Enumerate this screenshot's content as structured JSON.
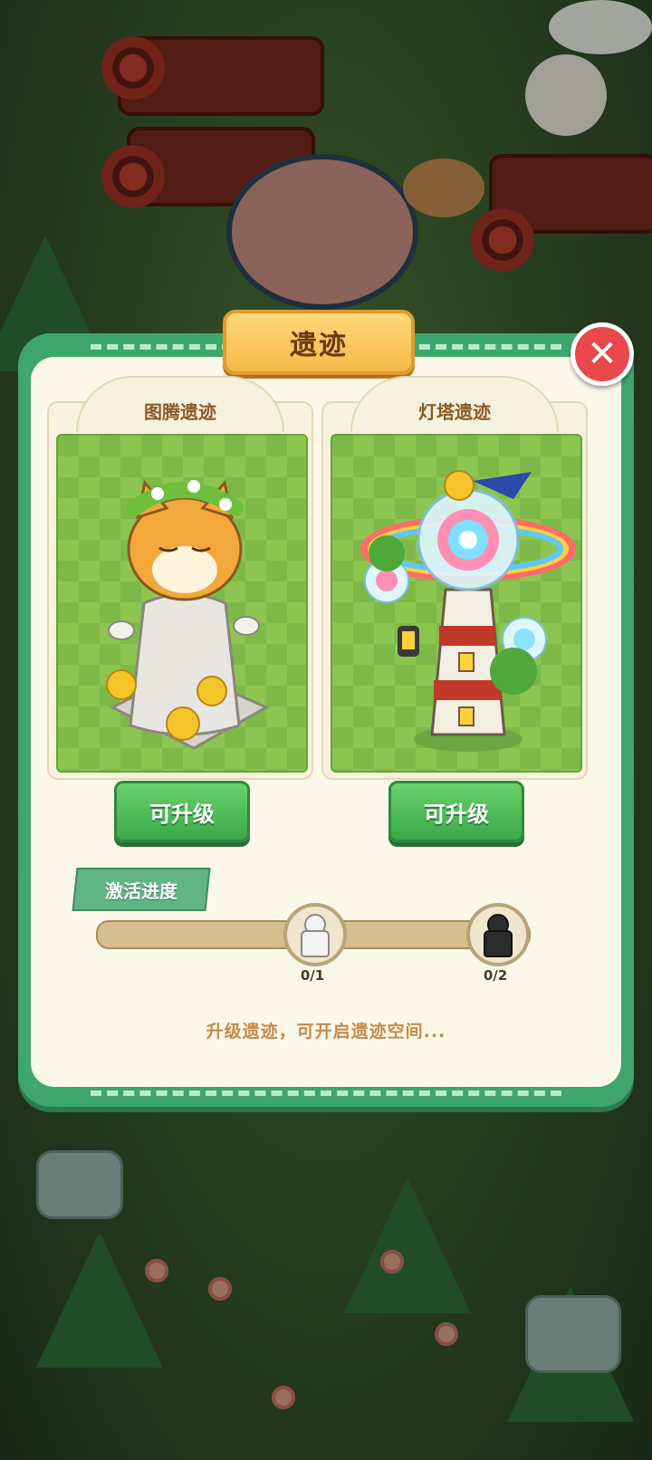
{
  "dialog": {
    "title": "遗迹",
    "close_icon": "close-icon"
  },
  "relics": [
    {
      "name": "图腾遗迹",
      "button_label": "可升级",
      "scene": "cat-totem-statue"
    },
    {
      "name": "灯塔遗迹",
      "button_label": "可升级",
      "scene": "rainbow-lighthouse"
    }
  ],
  "progress": {
    "tag_label": "激活进度",
    "milestones": [
      {
        "label": "0/1",
        "icon": "white-pawn-icon"
      },
      {
        "label": "0/2",
        "icon": "black-pawn-icon"
      }
    ]
  },
  "hint_text": "升级遗迹，可开启遗迹空间...",
  "colors": {
    "frame_green": "#3fa66e",
    "panel_cream": "#fbf8ea",
    "title_gold": "#f6b94a",
    "button_green": "#3ba84a",
    "close_red": "#e9494c",
    "hint_brown": "#c58a4a"
  }
}
